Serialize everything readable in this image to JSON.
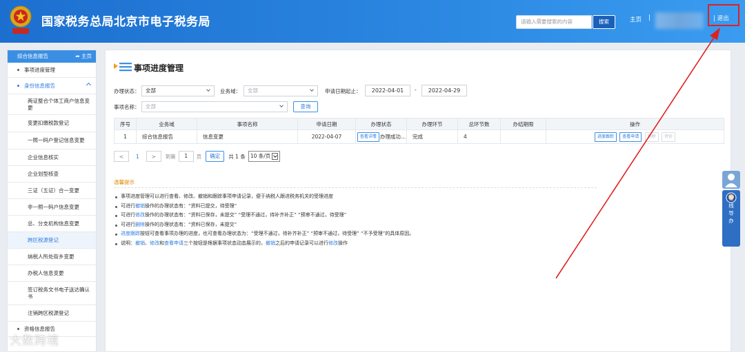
{
  "header": {
    "title": "国家税务总局北京市电子税务局",
    "search_placeholder": "请输入需要搜索的内容",
    "search_button": "搜索",
    "home": "主页",
    "separator": "|",
    "logout": "| 退出"
  },
  "sidebar": {
    "header_title": "综合信息报告",
    "header_home": "主页",
    "items": [
      {
        "label": "事项进度管理"
      },
      {
        "label": "身份信息报告"
      },
      {
        "label": "两证整合个体工商户信息变更"
      },
      {
        "label": "变更扣缴税款登记"
      },
      {
        "label": "一照一码户登记信息变更"
      },
      {
        "label": "企业信息核实"
      },
      {
        "label": "企业划型核查"
      },
      {
        "label": "三证（五证）合一变更"
      },
      {
        "label": "非一照一码户信息变更"
      },
      {
        "label": "总、分支机构信息变更"
      },
      {
        "label": "跨区税源登记"
      },
      {
        "label": "纳税人所处街乡变更"
      },
      {
        "label": "办税人信息变更"
      },
      {
        "label": "签订税务文书电子送达确认书"
      },
      {
        "label": "注销跨区税源登记"
      },
      {
        "label": "资格信息报告"
      }
    ]
  },
  "main": {
    "title": "事项进度管理",
    "filters": {
      "status_label": "办理状态：",
      "status_value": "全部",
      "domain_label": "业务域：",
      "domain_value": "全部",
      "date_label": "申请日期起止：",
      "date_start": "2022-04-01",
      "date_sep": "-",
      "date_end": "2022-04-29",
      "name_label": "事项名称：",
      "name_value": "全部",
      "query_button": "查询"
    },
    "table": {
      "headers": [
        "序号",
        "业务域",
        "事项名称",
        "申请日期",
        "办理状态",
        "办理环节",
        "总环节数",
        "办结期限",
        "操作"
      ],
      "row": {
        "index": "1",
        "domain": "综合信息报告",
        "name": "信息变更",
        "date": "2022-04-07",
        "status_btn": "查看详情",
        "status": "办理成功...",
        "step": "完成",
        "total_steps": "4",
        "deadline": "",
        "actions": [
          "进度跟踪",
          "查看申请",
          "删除",
          "评价"
        ]
      }
    },
    "pager": {
      "prev": "<",
      "page": "1",
      "next": ">",
      "goto": "到第",
      "goto_value": "1",
      "page_unit": "页",
      "confirm": "确定",
      "total": "共 1 条",
      "size": "10 条/页"
    },
    "tips": {
      "title": "温馨提示",
      "lines": [
        {
          "plain": "事项进度管理可以进行查看、修改、撤销和跟踪事项申请记录，便于纳税人跟进税务机关的受理进度"
        },
        {
          "pre": "可进行",
          "hl": "撤销",
          "post": "操作的办理状态有：“资料已提交，待受理”"
        },
        {
          "pre": "可进行",
          "hl": "修改",
          "post": "操作的办理状态有：“资料已保存，未提交”  “受理不通过，待补齐补正”  “预审不通过，待受理”"
        },
        {
          "pre": "可进行",
          "hl": "删除",
          "post": "操作的办理状态有：“资料已保存，未提交”"
        },
        {
          "hl": "进度跟踪",
          "post": "按钮可查看事项办理的进度，也可查看办理状态为：“受理不通过，待补齐补正”  “预审不通过，待受理”  “不予受理”的具体原因。"
        },
        {
          "pre": "说明：",
          "hl1": "撤销",
          "mid1": "、",
          "hl2": "修改",
          "mid2": "和",
          "hl3": "查看申请",
          "mid3": "三个按钮是根据事项状态动态展示的，",
          "hl4": "撤销",
          "mid4": "之后的申请记录可以进行",
          "hl5": "修改",
          "post": "操作"
        }
      ]
    }
  },
  "float_guide": {
    "label": "在线导办"
  },
  "watermark": {
    "text": "大数跨境"
  },
  "colors": {
    "header_blue": "#1d6fcf",
    "accent_blue": "#2d7be0",
    "tips_orange": "#e08a00",
    "annotation_red": "#e02020"
  }
}
